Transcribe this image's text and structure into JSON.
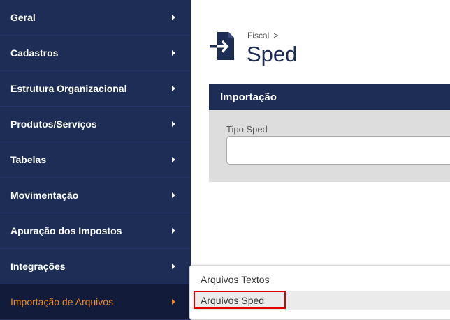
{
  "sidebar": {
    "items": [
      {
        "label": "Geral"
      },
      {
        "label": "Cadastros"
      },
      {
        "label": "Estrutura Organizacional"
      },
      {
        "label": "Produtos/Serviços"
      },
      {
        "label": "Tabelas"
      },
      {
        "label": "Movimentação"
      },
      {
        "label": "Apuração dos Impostos"
      },
      {
        "label": "Integrações"
      },
      {
        "label": "Importação de Arquivos"
      }
    ],
    "active_index": 8
  },
  "header": {
    "breadcrumb": "Fiscal",
    "breadcrumb_sep": ">",
    "title": "Sped",
    "icon": "file-import-icon"
  },
  "panel": {
    "title": "Importação",
    "field_label": "Tipo Sped",
    "field_value": ""
  },
  "flyout": {
    "items": [
      {
        "label": "Arquivos Textos"
      },
      {
        "label": "Arquivos Sped"
      }
    ],
    "hovered_index": 1
  },
  "colors": {
    "sidebar_bg": "#1e2d55",
    "active_bg": "#121b3a",
    "active_text": "#f08a24",
    "highlight": "#e00000"
  }
}
